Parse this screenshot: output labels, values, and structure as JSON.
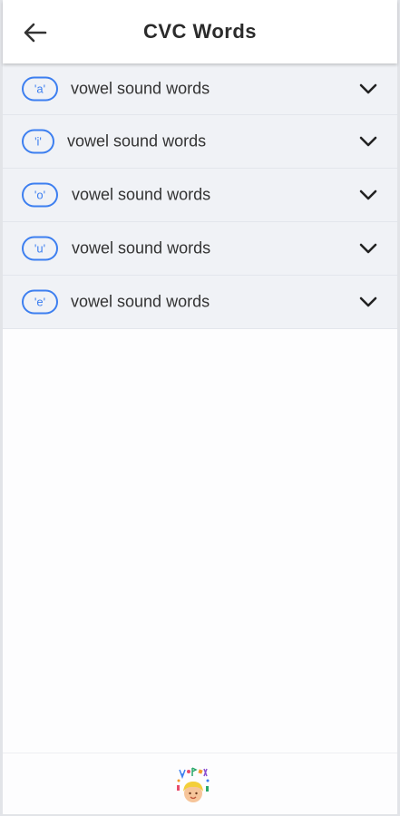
{
  "header": {
    "title": "CVC Words",
    "back_icon": "arrow-left-icon"
  },
  "vowel_groups": [
    {
      "badge": "'a'",
      "label": "vowel sound words",
      "icon": "chevron-down-icon"
    },
    {
      "badge": "'i'",
      "label": "vowel sound words",
      "icon": "chevron-down-icon"
    },
    {
      "badge": "'o'",
      "label": "vowel sound words",
      "icon": "chevron-down-icon"
    },
    {
      "badge": "'u'",
      "label": "vowel sound words",
      "icon": "chevron-down-icon"
    },
    {
      "badge": "'e'",
      "label": "vowel sound words",
      "icon": "chevron-down-icon"
    }
  ],
  "footer": {
    "logo": "kid-learning-logo"
  },
  "colors": {
    "accent": "#3d7ff0",
    "list_background": "#f0f2f6",
    "page_background": "#fdfdfe"
  }
}
